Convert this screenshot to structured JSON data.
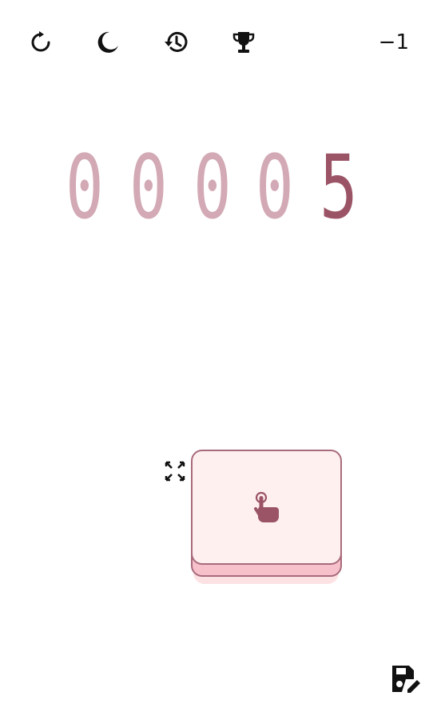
{
  "toolbar": {
    "reset_icon": "reset-icon",
    "theme_icon": "moon-icon",
    "history_icon": "history-icon",
    "trophy_icon": "trophy-icon",
    "step_value": "−1"
  },
  "counter": {
    "digits": [
      "0",
      "0",
      "0",
      "0",
      "5"
    ],
    "dim_color": "#d2a9b4",
    "active_color": "#9b5466"
  },
  "controls": {
    "fullscreen_icon": "fullscreen-icon",
    "tap_icon": "tap-hand-icon",
    "save_icon": "save-edit-icon"
  },
  "colors": {
    "button_face": "#fff0f0",
    "button_border": "#a86b7c",
    "button_base": "#f7c1cb",
    "button_shadow": "#fde2e4"
  }
}
